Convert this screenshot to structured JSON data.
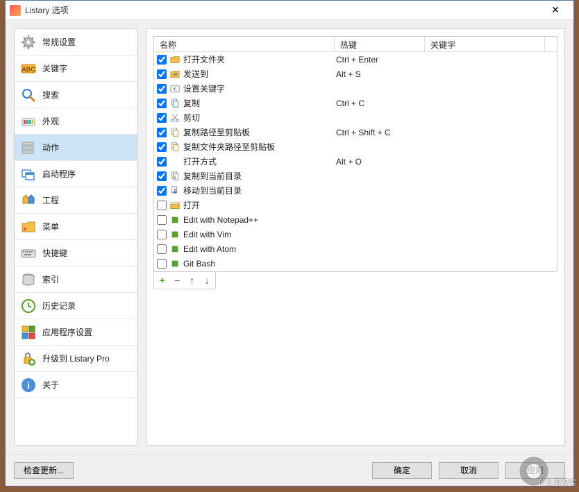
{
  "window": {
    "title": "Listary 选项"
  },
  "sidebar": {
    "items": [
      {
        "id": "general",
        "label": "常规设置"
      },
      {
        "id": "keywords",
        "label": "关键字"
      },
      {
        "id": "search",
        "label": "搜索"
      },
      {
        "id": "appearance",
        "label": "外观"
      },
      {
        "id": "actions",
        "label": "动作",
        "selected": true
      },
      {
        "id": "launcher",
        "label": "启动程序"
      },
      {
        "id": "projects",
        "label": "工程"
      },
      {
        "id": "menus",
        "label": "菜单"
      },
      {
        "id": "hotkeys",
        "label": "快捷键"
      },
      {
        "id": "index",
        "label": "索引"
      },
      {
        "id": "history",
        "label": "历史记录"
      },
      {
        "id": "appsettings",
        "label": "应用程序设置"
      },
      {
        "id": "upgrade",
        "label": "升级到 Listary Pro"
      },
      {
        "id": "about",
        "label": "关于"
      }
    ]
  },
  "columns": {
    "name": "名称",
    "hotkey": "热键",
    "keyword": "关键字"
  },
  "rows": [
    {
      "checked": true,
      "icon": "folder",
      "name": "打开文件夹",
      "hotkey": "Ctrl + Enter"
    },
    {
      "checked": true,
      "icon": "send",
      "name": "发送到",
      "hotkey": "Alt + S"
    },
    {
      "checked": true,
      "icon": "key",
      "name": "设置关键字",
      "hotkey": ""
    },
    {
      "checked": true,
      "icon": "copy",
      "name": "复制",
      "hotkey": "Ctrl + C"
    },
    {
      "checked": true,
      "icon": "cut",
      "name": "剪切",
      "hotkey": ""
    },
    {
      "checked": true,
      "icon": "copypath",
      "name": "复制路径至剪贴板",
      "hotkey": "Ctrl + Shift + C"
    },
    {
      "checked": true,
      "icon": "copypath",
      "name": "复制文件夹路径至剪贴板",
      "hotkey": ""
    },
    {
      "checked": true,
      "icon": "blank",
      "name": "打开方式",
      "hotkey": "Alt + O"
    },
    {
      "checked": true,
      "icon": "copyto",
      "name": "复制到当前目录",
      "hotkey": ""
    },
    {
      "checked": true,
      "icon": "moveto",
      "name": "移动到当前目录",
      "hotkey": ""
    },
    {
      "checked": false,
      "icon": "open",
      "name": "打开",
      "hotkey": ""
    },
    {
      "checked": false,
      "icon": "puzzle",
      "name": "Edit with Notepad++",
      "hotkey": ""
    },
    {
      "checked": false,
      "icon": "puzzle",
      "name": "Edit with Vim",
      "hotkey": ""
    },
    {
      "checked": false,
      "icon": "puzzle",
      "name": "Edit with Atom",
      "hotkey": ""
    },
    {
      "checked": false,
      "icon": "puzzle",
      "name": "Git Bash",
      "hotkey": ""
    }
  ],
  "toolbar": {
    "add": "+",
    "remove": "−",
    "up": "↑",
    "down": "↓"
  },
  "footer": {
    "check_updates": "检查更新...",
    "ok": "确定",
    "cancel": "取消",
    "apply": "应用"
  },
  "watermark": "什么值得买"
}
